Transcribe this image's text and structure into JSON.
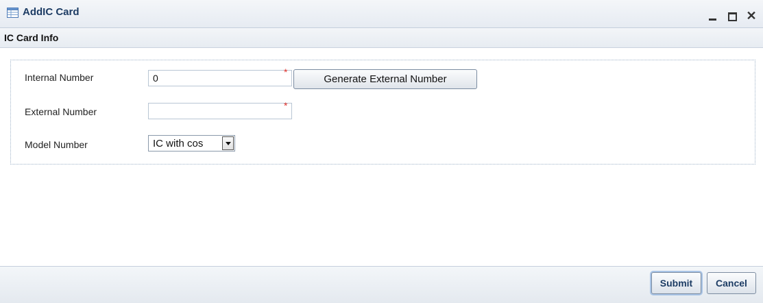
{
  "window": {
    "title": "AddIC Card",
    "icons": {
      "title": "table-icon",
      "minimize": "minimize-icon",
      "maximize": "maximize-icon",
      "close": "close-icon"
    },
    "close_glyph": "✕"
  },
  "section": {
    "title": "IC Card Info"
  },
  "form": {
    "internal_number": {
      "label": "Internal Number",
      "value": "0",
      "required_mark": "*"
    },
    "external_number": {
      "label": "External Number",
      "value": "",
      "required_mark": "*"
    },
    "model_number": {
      "label": "Model Number",
      "selected": "IC with cos"
    },
    "generate_button": "Generate External Number"
  },
  "footer": {
    "submit_label": "Submit",
    "cancel_label": "Cancel"
  },
  "colors": {
    "title_text": "#1d3c64",
    "required": "#e0302a",
    "header_bg": "#e6ebf2"
  }
}
